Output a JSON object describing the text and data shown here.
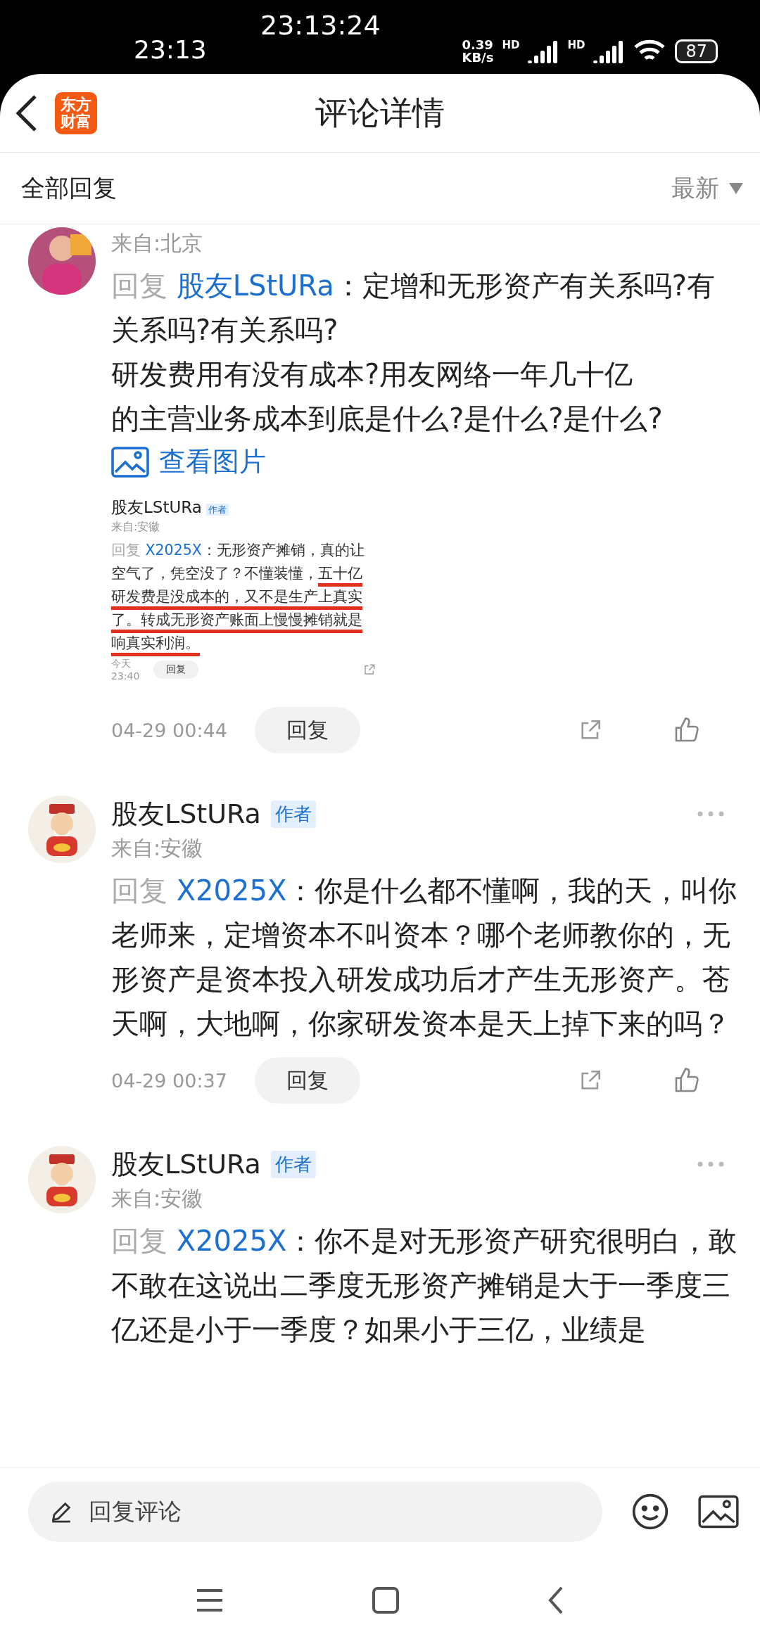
{
  "status_bar": {
    "time": "23:13",
    "overlay_clock": "23:13:24",
    "net_speed": [
      "0.39",
      "KB/s"
    ],
    "sim_labels": [
      "HD",
      "HD"
    ],
    "battery": "87"
  },
  "header": {
    "logo": [
      "东方",
      "财富"
    ],
    "title": "评论详情"
  },
  "sub_bar": {
    "label": "全部回复",
    "sort": "最新"
  },
  "comments": [
    {
      "kind": "partial",
      "location": "来自:北京",
      "reply_prefix": "回复",
      "reply_to": "股友LStURa",
      "text": "：定增和无形资产有关系吗?有关系吗?有关系吗?",
      "more_text": [
        "研发费用有没有成本?用友网络一年几十亿",
        "的主营业务成本到底是什么?是什么?是什么?"
      ],
      "image_link": "查看图片",
      "screenshot": {
        "name": "股友LStURa",
        "badge": "作者",
        "location": "来自:安徽",
        "reply_prefix": "回复",
        "reply_to": "X2025X",
        "lines": [
          {
            "parts": [
              {
                "text": "：无形资产摊销，真的让",
                "underlined": false
              }
            ]
          },
          {
            "parts": [
              {
                "text": "空气了，凭空没了？不懂装懂，",
                "underlined": false
              },
              {
                "text": "五十亿",
                "underlined": true
              }
            ]
          },
          {
            "parts": [
              {
                "text": "研发费是没成本的，又不是生产上真实",
                "underlined": true
              }
            ]
          },
          {
            "parts": [
              {
                "text": "了。转成无形资产账面上慢慢摊销就是",
                "underlined": true
              }
            ]
          },
          {
            "parts": [
              {
                "text": "响真实利润。",
                "underlined": true
              }
            ]
          }
        ],
        "date": "今天 23:40",
        "reply_button": "回复"
      },
      "date": "04-29 00:44",
      "reply_button": "回复"
    },
    {
      "kind": "full",
      "name": "股友LStURa",
      "badge": "作者",
      "location": "来自:安徽",
      "reply_prefix": "回复",
      "reply_to": "X2025X",
      "text": "：你是什么都不懂啊，我的天，叫你老师来，定增资本不叫资本？哪个老师教你的，无形资产是资本投入研发成功后才产生无形资产。苍天啊，大地啊，你家研发资本是天上掉下来的吗？",
      "date": "04-29 00:37",
      "reply_button": "回复"
    },
    {
      "kind": "full",
      "name": "股友LStURa",
      "badge": "作者",
      "location": "来自:安徽",
      "reply_prefix": "回复",
      "reply_to": "X2025X",
      "text": "：你不是对无形资产研究很明白，敢不敢在这说出二季度无形资产摊销是大于一季度三亿还是小于一季度？如果小于三亿，业绩是"
    }
  ],
  "composer": {
    "placeholder": "回复评论"
  }
}
